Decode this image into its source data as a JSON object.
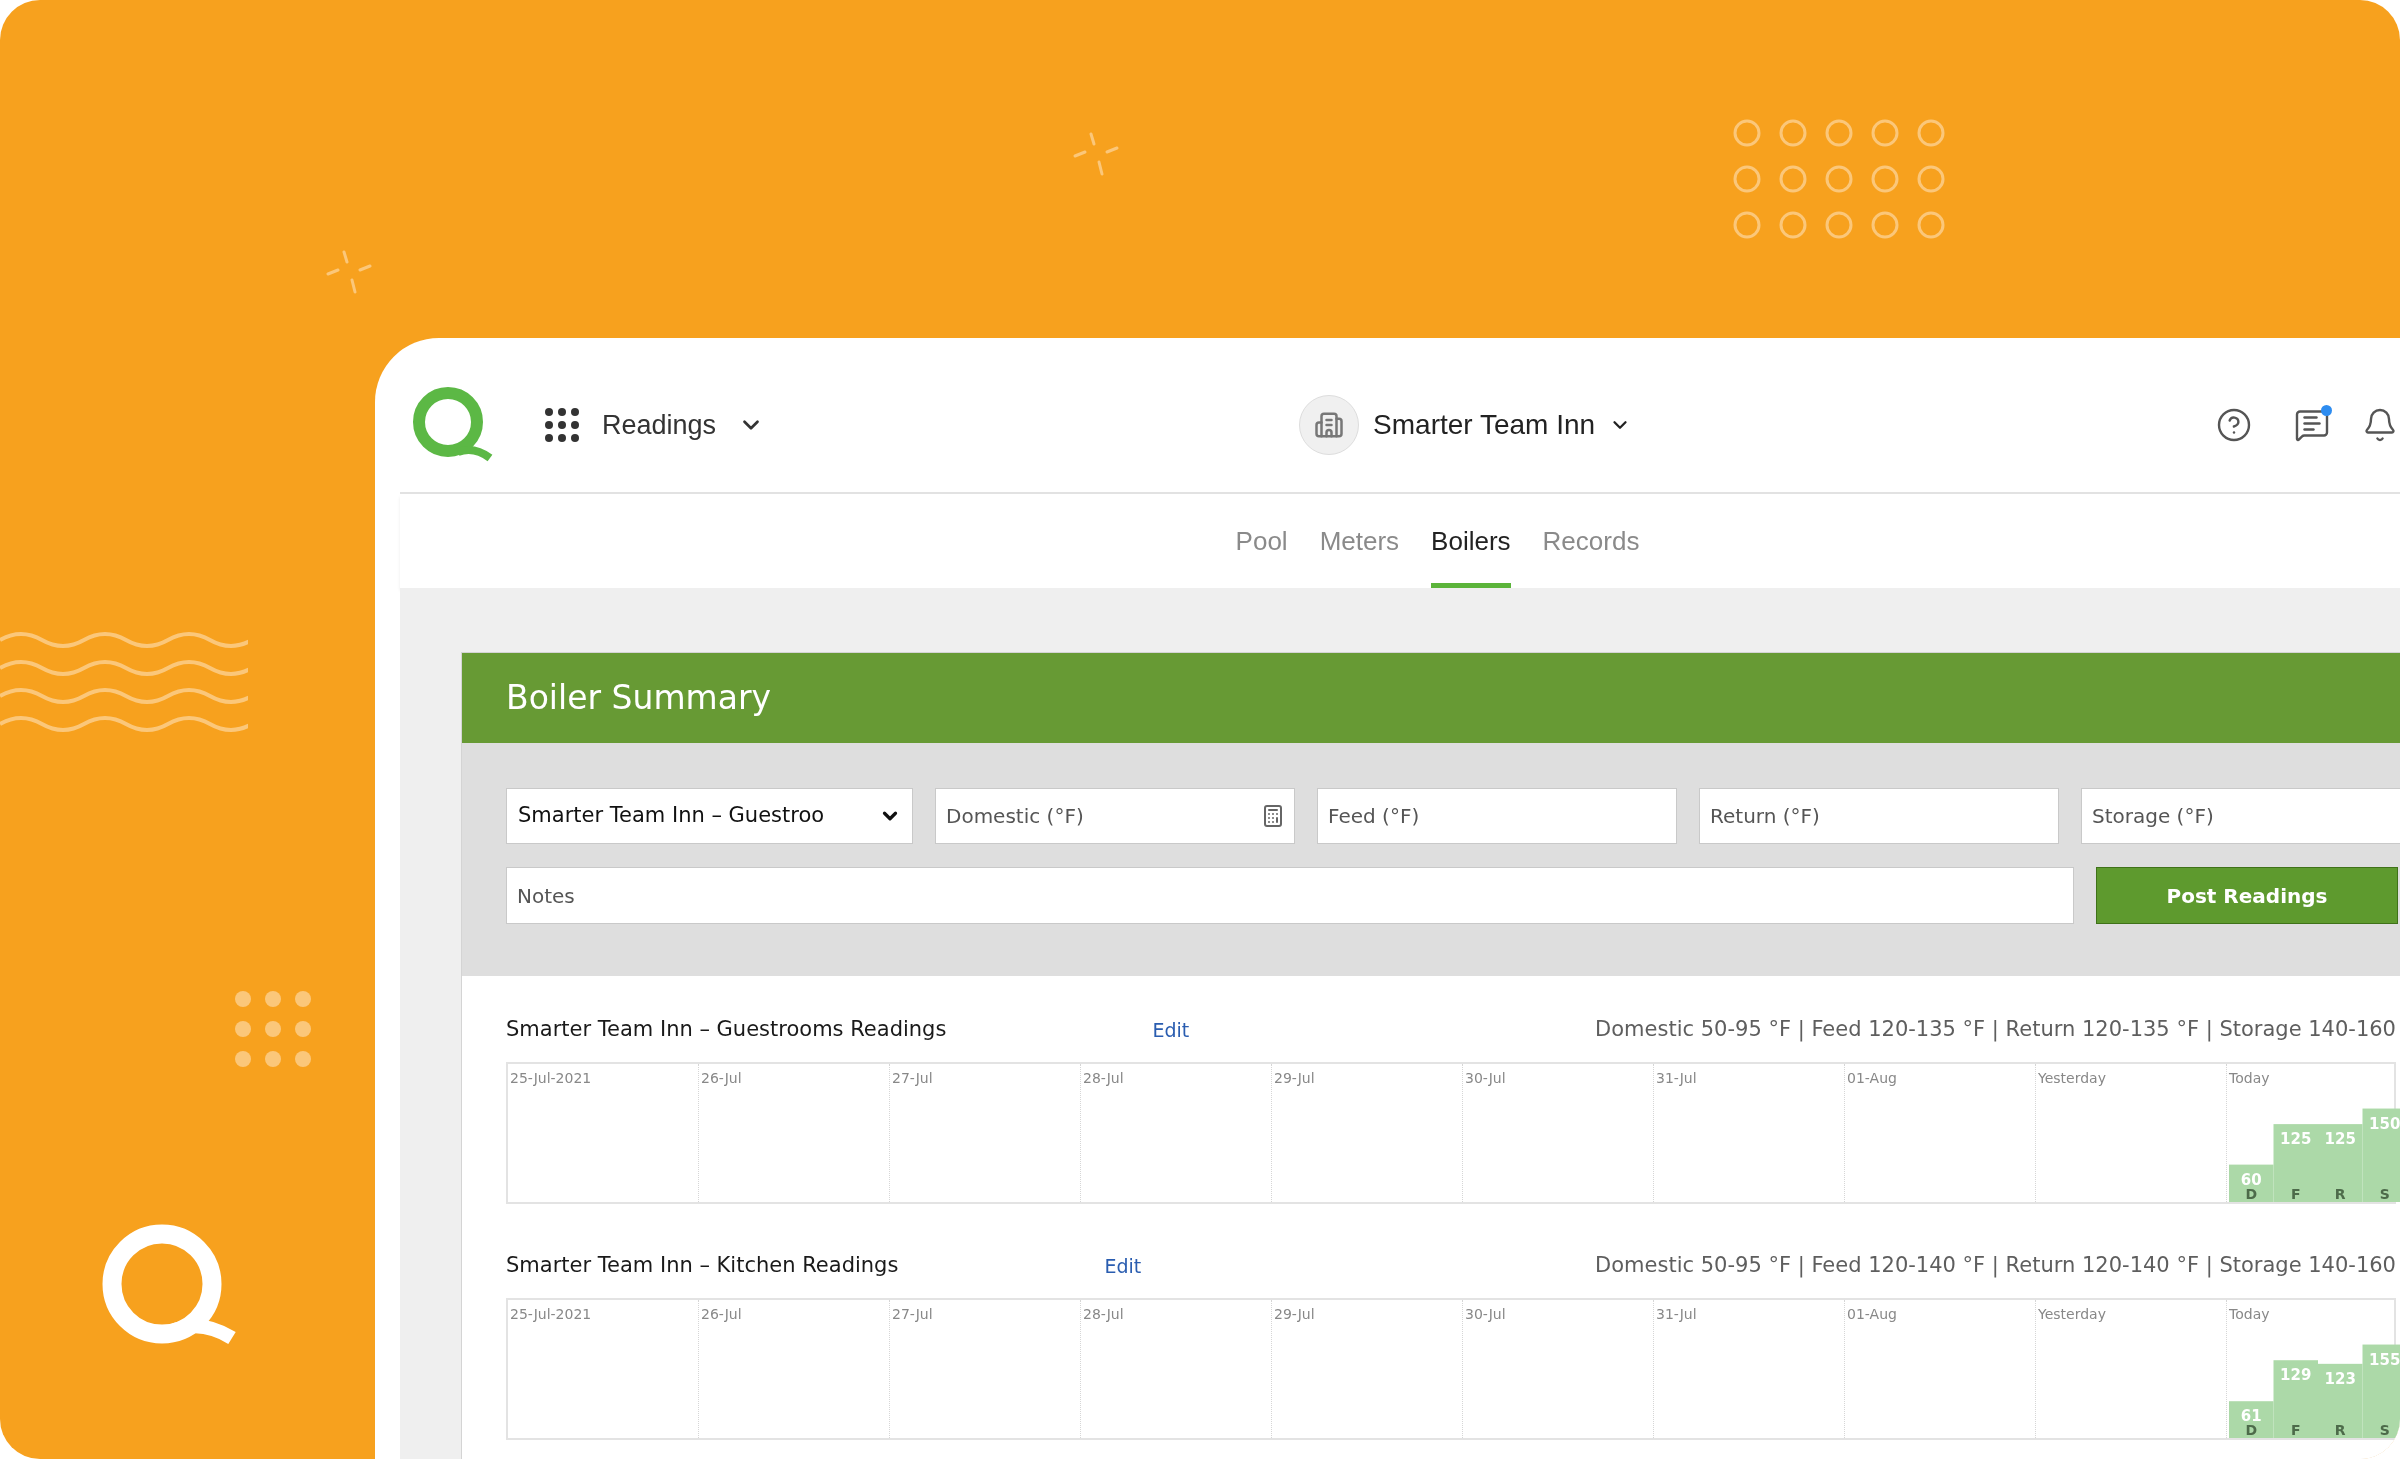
{
  "nav": {
    "app_menu": "Readings",
    "property": "Smarter Team Inn",
    "messages_unread": true
  },
  "tabs": [
    {
      "label": "Pool",
      "selected": false
    },
    {
      "label": "Meters",
      "selected": false
    },
    {
      "label": "Boilers",
      "selected": true
    },
    {
      "label": "Records",
      "selected": false
    }
  ],
  "panel": {
    "title": "Boiler Summary",
    "building_select": "Smarter Team Inn – Guestroo",
    "fields": [
      {
        "placeholder": "Domestic (°F)",
        "kind": "calculator"
      },
      {
        "placeholder": "Feed (°F)",
        "kind": "plain"
      },
      {
        "placeholder": "Return (°F)",
        "kind": "plain"
      },
      {
        "placeholder": "Storage (°F)",
        "kind": "plain"
      }
    ],
    "notes": {
      "placeholder": "Notes"
    },
    "submit": "Post Readings"
  },
  "groups": [
    {
      "title": "Smarter Team Inn – Guestrooms Readings",
      "edit": "Edit",
      "ranges": "Domestic 50-95 °F | Feed 120-135 °F | Return 120-135 °F | Storage 140-160",
      "days": [
        "25-Jul-2021",
        "26-Jul",
        "27-Jul",
        "28-Jul",
        "29-Jul",
        "30-Jul",
        "31-Jul",
        "01-Aug",
        "Yesterday",
        "Today"
      ],
      "chart_data": {
        "type": "bar",
        "categories": [
          "D",
          "F",
          "R",
          "S"
        ],
        "values": [
          60,
          125,
          125,
          150
        ],
        "data_labels": true
      }
    },
    {
      "title": "Smarter Team Inn – Kitchen Readings",
      "edit": "Edit",
      "ranges": "Domestic 50-95 °F | Feed 120-140 °F | Return 120-140 °F | Storage 140-160",
      "days": [
        "25-Jul-2021",
        "26-Jul",
        "27-Jul",
        "28-Jul",
        "29-Jul",
        "30-Jul",
        "31-Jul",
        "01-Aug",
        "Yesterday",
        "Today"
      ],
      "chart_data": {
        "type": "bar",
        "categories": [
          "D",
          "F",
          "R",
          "S"
        ],
        "values": [
          61,
          129,
          123,
          155
        ],
        "data_labels": true
      }
    }
  ]
}
